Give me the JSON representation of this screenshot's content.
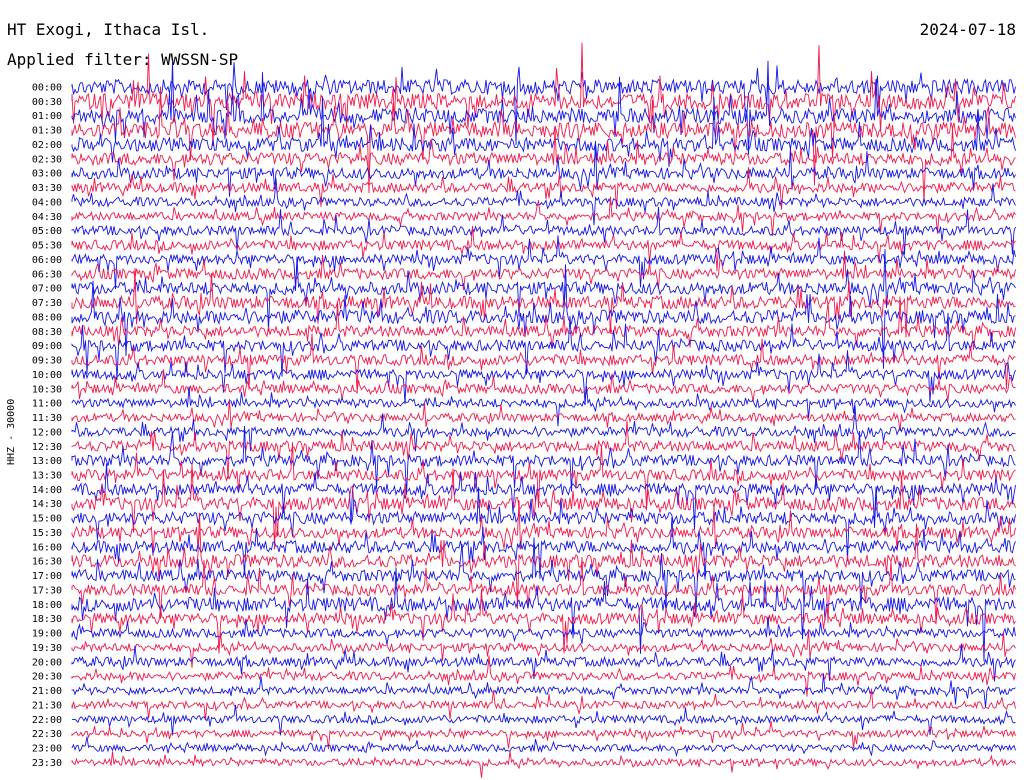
{
  "header": {
    "station": "HT Exogi, Ithaca Isl.",
    "date": "2024-07-18",
    "filter": "Applied filter: WWSSN-SP"
  },
  "channel_label": "HHZ - 30000",
  "colors": {
    "blue": "#1515e6",
    "red": "#f0194a"
  },
  "chart_data": {
    "type": "line",
    "title": "HT Exogi, Ithaca Isl.",
    "subtitle": "Applied filter: WWSSN-SP",
    "ylabel": "HHZ - 30000",
    "xlabel": "",
    "rows": [
      "00:00",
      "00:30",
      "01:00",
      "01:30",
      "02:00",
      "02:30",
      "03:00",
      "03:30",
      "04:00",
      "04:30",
      "05:00",
      "05:30",
      "06:00",
      "06:30",
      "07:00",
      "07:30",
      "08:00",
      "08:30",
      "09:00",
      "09:30",
      "10:00",
      "10:30",
      "11:00",
      "11:30",
      "12:00",
      "12:30",
      "13:00",
      "13:30",
      "14:00",
      "14:30",
      "15:00",
      "15:30",
      "16:00",
      "16:30",
      "17:00",
      "17:30",
      "18:00",
      "18:30",
      "19:00",
      "19:30",
      "20:00",
      "20:30",
      "21:00",
      "21:30",
      "22:00",
      "22:30",
      "23:00",
      "23:30"
    ],
    "row_activity": [
      0.9,
      1.0,
      0.9,
      1.0,
      0.8,
      0.7,
      0.6,
      0.5,
      0.4,
      0.35,
      0.45,
      0.5,
      0.5,
      0.55,
      0.7,
      0.75,
      0.8,
      0.6,
      0.6,
      0.55,
      0.5,
      0.45,
      0.4,
      0.35,
      0.45,
      0.55,
      0.6,
      0.6,
      0.65,
      0.75,
      0.7,
      0.6,
      0.7,
      0.75,
      0.65,
      0.6,
      0.85,
      0.6,
      0.4,
      0.35,
      0.45,
      0.35,
      0.3,
      0.3,
      0.3,
      0.25,
      0.25,
      0.25
    ],
    "series_colors": [
      "blue",
      "red"
    ],
    "grid": false
  }
}
